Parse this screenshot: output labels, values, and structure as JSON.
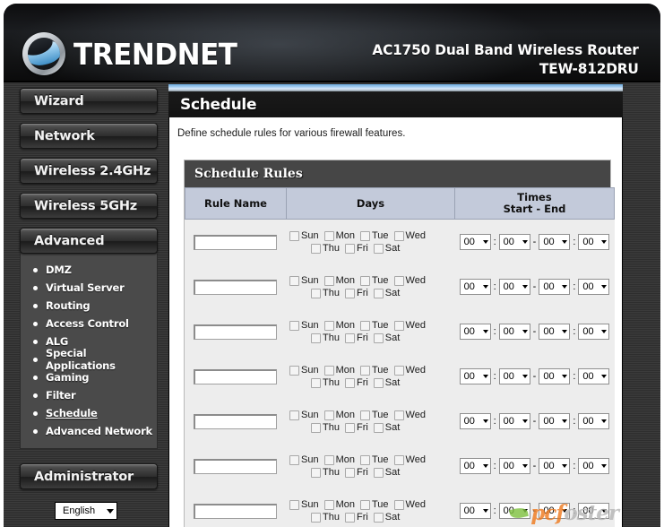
{
  "header": {
    "brand": "TRENDNET",
    "product_line1": "AC1750 Dual Band Wireless Router",
    "product_line2": "TEW-812DRU"
  },
  "sidebar": {
    "buttons": [
      {
        "label": "Wizard"
      },
      {
        "label": "Network"
      },
      {
        "label": "Wireless 2.4GHz"
      },
      {
        "label": "Wireless 5GHz"
      },
      {
        "label": "Advanced"
      }
    ],
    "advanced_submenu": [
      {
        "label": "DMZ",
        "active": false
      },
      {
        "label": "Virtual Server",
        "active": false
      },
      {
        "label": "Routing",
        "active": false
      },
      {
        "label": "Access Control",
        "active": false
      },
      {
        "label": "ALG",
        "active": false
      },
      {
        "label": "Special Applications",
        "active": false
      },
      {
        "label": "Gaming",
        "active": false
      },
      {
        "label": "Filter",
        "active": false
      },
      {
        "label": "Schedule",
        "active": true
      },
      {
        "label": "Advanced Network",
        "active": false
      }
    ],
    "administrator_label": "Administrator",
    "language": {
      "selected": "English",
      "options": [
        "English"
      ]
    }
  },
  "main": {
    "page_title": "Schedule",
    "intro": "Define schedule rules for various firewall features.",
    "panel_title": "Schedule Rules",
    "columns": {
      "rule_name": "Rule Name",
      "days": "Days",
      "times_line1": "Times",
      "times_line2": "Start - End"
    },
    "day_labels_row1": [
      "Sun",
      "Mon",
      "Tue",
      "Wed"
    ],
    "day_labels_row2": [
      "Thu",
      "Fri",
      "Sat"
    ],
    "time_separator_colon": ":",
    "time_separator_dash": "-",
    "rows": [
      {
        "rule_name": "",
        "rule_name_placeholder": "",
        "days_checked": {
          "Sun": false,
          "Mon": false,
          "Tue": false,
          "Wed": false,
          "Thu": false,
          "Fri": false,
          "Sat": false
        },
        "start_hour": "00",
        "start_minute": "00",
        "end_hour": "00",
        "end_minute": "00"
      },
      {
        "rule_name": "",
        "rule_name_placeholder": "",
        "days_checked": {
          "Sun": false,
          "Mon": false,
          "Tue": false,
          "Wed": false,
          "Thu": false,
          "Fri": false,
          "Sat": false
        },
        "start_hour": "00",
        "start_minute": "00",
        "end_hour": "00",
        "end_minute": "00"
      },
      {
        "rule_name": "",
        "rule_name_placeholder": "",
        "days_checked": {
          "Sun": false,
          "Mon": false,
          "Tue": false,
          "Wed": false,
          "Thu": false,
          "Fri": false,
          "Sat": false
        },
        "start_hour": "00",
        "start_minute": "00",
        "end_hour": "00",
        "end_minute": "00"
      },
      {
        "rule_name": "",
        "rule_name_placeholder": "",
        "days_checked": {
          "Sun": false,
          "Mon": false,
          "Tue": false,
          "Wed": false,
          "Thu": false,
          "Fri": false,
          "Sat": false
        },
        "start_hour": "00",
        "start_minute": "00",
        "end_hour": "00",
        "end_minute": "00"
      },
      {
        "rule_name": "",
        "rule_name_placeholder": "",
        "days_checked": {
          "Sun": false,
          "Mon": false,
          "Tue": false,
          "Wed": false,
          "Thu": false,
          "Fri": false,
          "Sat": false
        },
        "start_hour": "00",
        "start_minute": "00",
        "end_hour": "00",
        "end_minute": "00"
      },
      {
        "rule_name": "",
        "rule_name_placeholder": "",
        "days_checked": {
          "Sun": false,
          "Mon": false,
          "Tue": false,
          "Wed": false,
          "Thu": false,
          "Fri": false,
          "Sat": false
        },
        "start_hour": "00",
        "start_minute": "00",
        "end_hour": "00",
        "end_minute": "00"
      },
      {
        "rule_name": "",
        "rule_name_placeholder": "",
        "days_checked": {
          "Sun": false,
          "Mon": false,
          "Tue": false,
          "Wed": false,
          "Thu": false,
          "Fri": false,
          "Sat": false
        },
        "start_hour": "00",
        "start_minute": "00",
        "end_hour": "00",
        "end_minute": "00"
      }
    ]
  },
  "watermark": {
    "text_part1": "pcf",
    "text_part2": "oster"
  },
  "colors": {
    "accent_blue": "#6aa9de",
    "header_dark": "#131313",
    "panel_head": "#464646",
    "table_header": "#c3cada",
    "row_bg": "#ededed",
    "watermark_orange": "#ef7b20",
    "watermark_green": "#7fc242"
  }
}
